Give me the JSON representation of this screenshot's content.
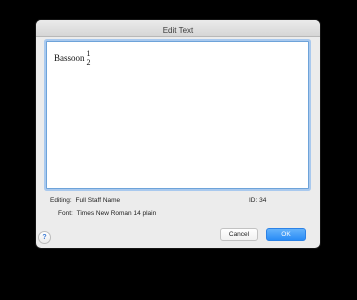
{
  "window": {
    "title": "Edit Text"
  },
  "editor": {
    "staff_name": "Bassoon",
    "stack_top": "1",
    "stack_bottom": "2"
  },
  "info": {
    "editing_label": "Editing:",
    "editing_value": "Full Staff Name",
    "id_label": "ID:",
    "id_value": "34",
    "font_label": "Font:",
    "font_value": "Times New Roman 14 plain"
  },
  "buttons": {
    "cancel": "Cancel",
    "ok": "OK",
    "help": "?"
  }
}
